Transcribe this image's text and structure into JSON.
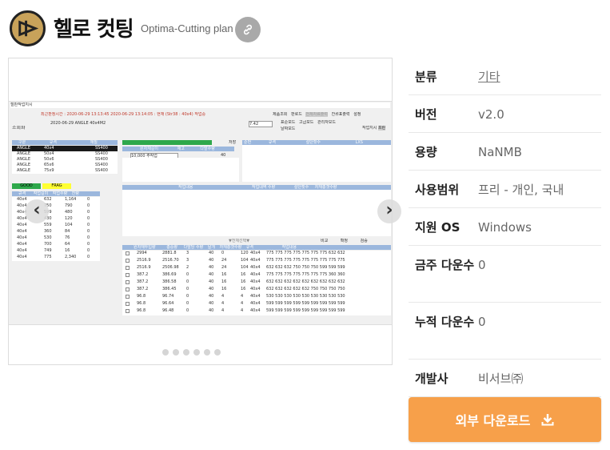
{
  "header": {
    "title": "헬로 컷팅",
    "subtitle": "Optima-Cutting plan",
    "link_icon": "link-icon",
    "logo_icon": "cutting-logo-icon"
  },
  "gallery": {
    "prev_icon": "chevron-left-icon",
    "next_icon": "chevron-right-icon",
    "dot_count": 6,
    "screenshot": {
      "window_title": "철판작업지시",
      "top_text": "최근판정시간 : 2020-06-29 13:13:45   2020-06-29 13:14:05 : 현재 (Str38 : 40x4) 작업중",
      "buttons": [
        "제품조회",
        "판로드",
        "전체자료출력",
        "잔류표출력",
        "설정"
      ],
      "search_label": "조회화",
      "date_text": "2020-06-29  ANGLE 40x4M2",
      "value_74": "7.42",
      "radio_options": [
        "표준모드",
        "고급모드",
        "관리자모드",
        "날짜모드"
      ],
      "work_label": "작업지시",
      "print_label": "프린",
      "left_table": {
        "headers": [
          "구분",
          "규격",
          "재질"
        ],
        "rows": [
          [
            "ANGLE",
            "40x4",
            "SS400"
          ],
          [
            "ANGLE",
            "50x4",
            "SS400"
          ],
          [
            "ANGLE",
            "50x6",
            "SS400"
          ],
          [
            "ANGLE",
            "65x6",
            "SS400"
          ],
          [
            "ANGLE",
            "75x9",
            "SS400"
          ]
        ]
      },
      "mid_table": {
        "headers": [
          "원자재길이",
          "재고",
          "다발수량"
        ],
        "row": [
          "10,000 주작업",
          "40"
        ],
        "save_label": "저장"
      },
      "right_table": {
        "headers": [
          "순번",
          "규격",
          "절단횟수",
          "LXS"
        ]
      },
      "good_label": "GOOD",
      "frag_label": "FRAG",
      "cut_table": {
        "headers": [
          "규격",
          "작업길이",
          "작업수량",
          "잔량"
        ],
        "rows": [
          [
            "40x4",
            "632",
            "1,164",
            "0"
          ],
          [
            "40x4",
            "750",
            "790",
            "0"
          ],
          [
            "40x4",
            "599",
            "480",
            "0"
          ],
          [
            "40x4",
            "430",
            "120",
            "0"
          ],
          [
            "40x4",
            "559",
            "104",
            "0"
          ],
          [
            "40x4",
            "360",
            "84",
            "0"
          ],
          [
            "40x4",
            "530",
            "76",
            "0"
          ],
          [
            "40x4",
            "700",
            "64",
            "0"
          ],
          [
            "40x4",
            "749",
            "16",
            "0"
          ],
          [
            "40x4",
            "775",
            "2,340",
            "0"
          ]
        ]
      },
      "plan_table": {
        "headers": [
          "작업내용",
          "작업내역 수량",
          "절단횟수",
          "자재총갯수량"
        ]
      },
      "bottom_bar_label": "▼전체선택▼",
      "bottom_buttons": [
        "비교",
        "확정",
        "검증"
      ],
      "result_table": {
        "headers": [
          "원자재투입량",
          "총중량",
          "다발당 수량",
          "날개",
          "자재총갯수량",
          "규격",
          "작업내용"
        ],
        "rows": [
          [
            "2994",
            "2881.8",
            "3",
            "40",
            "0",
            "120",
            "40x4",
            "775 775 775 775 775 775 775 632 632"
          ],
          [
            "2516.9",
            "2516.70",
            "3",
            "40",
            "24",
            "104",
            "40x4",
            "775 775 775 775 775 775 775 775 775"
          ],
          [
            "2516.9",
            "2506.98",
            "2",
            "40",
            "24",
            "104",
            "40x4",
            "632 632 632 750 750 750 599 599 599"
          ],
          [
            "387.2",
            "386.69",
            "0",
            "40",
            "16",
            "16",
            "40x4",
            "775 775 775 775 775 775 775 360 360"
          ],
          [
            "387.2",
            "386.58",
            "0",
            "40",
            "16",
            "16",
            "40x4",
            "632 632 632 632 632 632 632 632 632"
          ],
          [
            "387.2",
            "386.45",
            "0",
            "40",
            "16",
            "16",
            "40x4",
            "632 632 632 632 632 750 750 750 750"
          ],
          [
            "96.8",
            "96.74",
            "0",
            "40",
            "4",
            "4",
            "40x4",
            "530 530 530 530 530 530 530 530 530"
          ],
          [
            "96.8",
            "96.64",
            "0",
            "40",
            "4",
            "4",
            "40x4",
            "599 599 599 599 599 599 599 599 599"
          ],
          [
            "96.8",
            "96.48",
            "0",
            "40",
            "4",
            "4",
            "40x4",
            "599 599 599 599 599 599 599 599 599"
          ]
        ]
      }
    }
  },
  "info": {
    "rows": [
      {
        "label": "분류",
        "value": "기타",
        "link": true
      },
      {
        "label": "버전",
        "value": "v2.0"
      },
      {
        "label": "용량",
        "value": "NaNMB"
      },
      {
        "label": "사용범위",
        "value": "프리 - 개인, 국내"
      },
      {
        "label": "지원 OS",
        "value": "Windows"
      },
      {
        "label": "금주 다운수",
        "value": "0"
      },
      {
        "label": "누적 다운수",
        "value": "0"
      },
      {
        "label": "개발사",
        "value": "비서브㈜"
      }
    ]
  },
  "download": {
    "label": "외부 다운로드",
    "icon": "download-icon"
  },
  "colors": {
    "accent": "#f7a04a",
    "header_blue": "#9bb7dd",
    "good": "#2ea84b",
    "frag": "#ffff33"
  }
}
